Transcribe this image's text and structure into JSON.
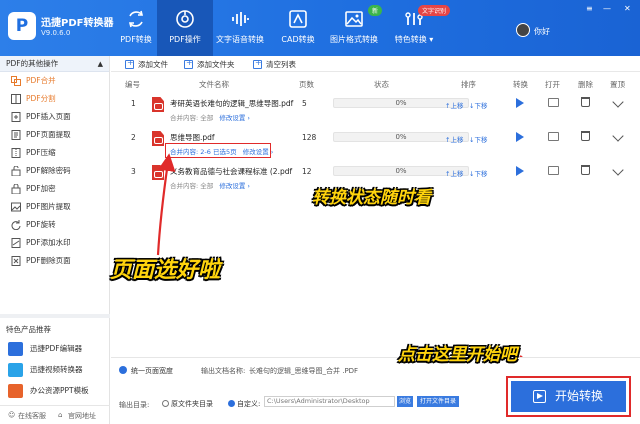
{
  "app": {
    "name": "迅捷PDF转换器",
    "version": "V9.0.6.0",
    "logo_letter": "P"
  },
  "nav": [
    {
      "label": "PDF转换",
      "icon": "convert-icon"
    },
    {
      "label": "PDF操作",
      "icon": "pdf-operate-icon"
    },
    {
      "label": "文字语音转换",
      "icon": "voice-icon"
    },
    {
      "label": "CAD转换",
      "icon": "cad-icon"
    },
    {
      "label": "图片格式转换",
      "icon": "image-icon"
    },
    {
      "label": "特色转换 ▾",
      "icon": "special-icon"
    }
  ],
  "badges": {
    "new": "新",
    "ocr": "文字识别"
  },
  "user": {
    "name": "你好"
  },
  "window": {
    "settings": "≡",
    "minimize": "—",
    "close": "✕"
  },
  "sidebar": {
    "header": "PDF的其他操作",
    "header_chevron": "▲",
    "items": [
      {
        "label": "PDF合并"
      },
      {
        "label": "PDF分割"
      },
      {
        "label": "PDF插入页面"
      },
      {
        "label": "PDF页面提取"
      },
      {
        "label": "PDF压缩"
      },
      {
        "label": "PDF解除密码"
      },
      {
        "label": "PDF加密"
      },
      {
        "label": "PDF图片提取"
      },
      {
        "label": "PDF旋转"
      },
      {
        "label": "PDF添加水印"
      },
      {
        "label": "PDF删除页面"
      }
    ],
    "featured_title": "特色产品推荐",
    "products": [
      {
        "label": "迅捷PDF编辑器"
      },
      {
        "label": "迅捷视频转换器"
      },
      {
        "label": "办公资源PPT模板"
      }
    ],
    "footer": {
      "service": "在线客服",
      "website": "官网地址"
    }
  },
  "toolbar": {
    "add_file": "添加文件",
    "add_folder": "添加文件夹",
    "clear": "清空列表"
  },
  "table": {
    "headers": {
      "idx": "编号",
      "name": "文件名称",
      "pages": "页数",
      "status": "状态",
      "order": "排序",
      "convert": "转换",
      "open": "打开",
      "delete": "删除",
      "pin": "置顶"
    },
    "rows": [
      {
        "idx": "1",
        "name": "考研英语长难句的逻辑_思维导图.pdf",
        "merge_label": "合并内容:",
        "merge_value": "全部",
        "modify": "修改设置 ›",
        "pages": "5",
        "progress": "0%"
      },
      {
        "idx": "2",
        "name": "思维导图.pdf",
        "merge_label": "合并内容:",
        "merge_value": "2-6 已选5页",
        "modify": "修改设置 ›",
        "pages": "128",
        "progress": "0%"
      },
      {
        "idx": "3",
        "name": "义务教育品德与社会课程标准 (2.pdf",
        "merge_label": "合并内容:",
        "merge_value": "全部",
        "modify": "修改设置 ›",
        "pages": "12",
        "progress": "0%"
      }
    ],
    "up_label": "↑上移",
    "down_label": "↓下移"
  },
  "annotations": {
    "status": "转换状态随时看",
    "pages_ok": "页面选好啦",
    "click_here": "点击这里开始吧"
  },
  "bottom": {
    "unify_size": "统一页面宽度",
    "output_name_label": "输出文档名称:",
    "output_name_value": "长难句的逻辑_思维导图_合并 .PDF",
    "output_dir_label": "输出目录:",
    "src_dir": "原文件夹目录",
    "custom": "自定义:",
    "path": "C:\\Users\\Administrator\\Desktop",
    "browse": "浏览",
    "open_folder": "打开文件目录",
    "start": "开始转换"
  },
  "colors": {
    "brand": "#1f6fe0",
    "accent_orange": "#e77a2b",
    "highlight_red": "#e02a2a",
    "annotation_yellow": "#ffd40d"
  }
}
